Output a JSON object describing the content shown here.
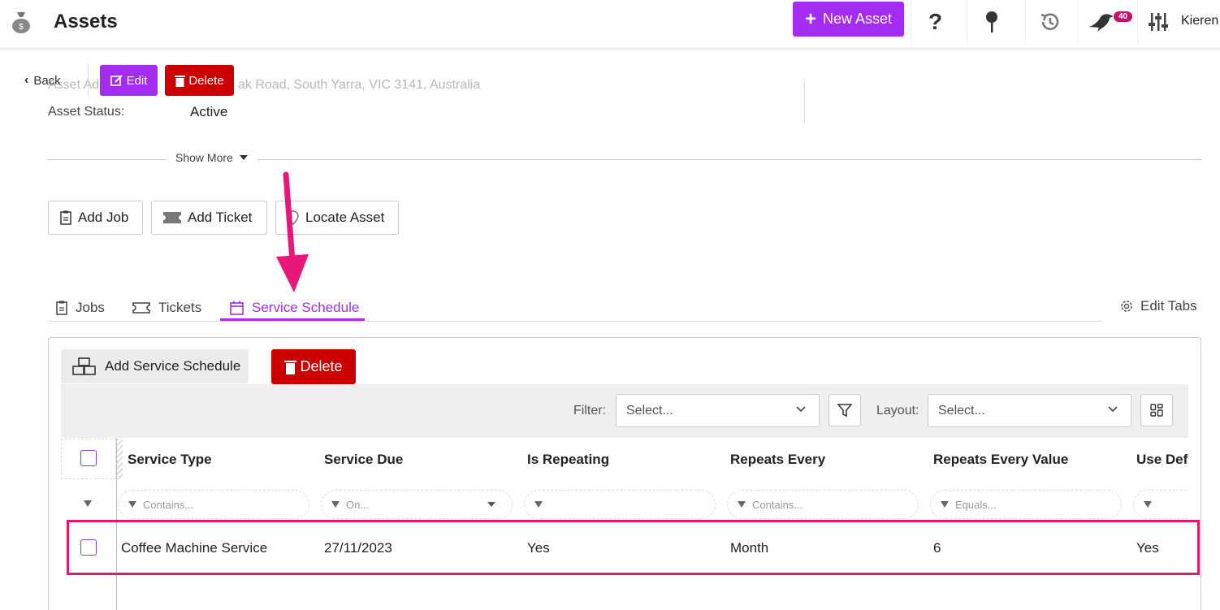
{
  "app": {
    "title": "Assets"
  },
  "topbar": {
    "new_asset_label": "New Asset",
    "notification_count": "40",
    "user_name": "Kieren"
  },
  "header": {
    "back_label": "Back",
    "edit_label": "Edit",
    "delete_label": "Delete",
    "asset_address_label_fragment": "Asset Ad",
    "asset_address_value_fragment": "ak Road, South Yarra, VIC 3141, Australia",
    "asset_status_label": "Asset Status:",
    "asset_status_value": "Active",
    "show_more_label": "Show More"
  },
  "actions": {
    "add_job": "Add Job",
    "add_ticket": "Add Ticket",
    "locate_asset": "Locate Asset"
  },
  "tabs": {
    "jobs": "Jobs",
    "tickets": "Tickets",
    "service_schedule": "Service Schedule",
    "active": "Service Schedule",
    "edit_tabs": "Edit Tabs"
  },
  "panel": {
    "add_service_schedule": "Add Service Schedule",
    "delete_label": "Delete",
    "filter_label": "Filter:",
    "filter_placeholder": "Select...",
    "layout_label": "Layout:",
    "layout_placeholder": "Select..."
  },
  "grid": {
    "columns": [
      "Service Type",
      "Service Due",
      "Is Repeating",
      "Repeats Every",
      "Repeats Every Value",
      "Use Defa"
    ],
    "filters": [
      "Contains...",
      "On...",
      "",
      "Contains...",
      "Equals...",
      ""
    ],
    "rows": [
      [
        "Coffee Machine Service",
        "27/11/2023",
        "Yes",
        "Month",
        "6",
        "Yes"
      ]
    ]
  },
  "colors": {
    "accent_purple": "#a32cf0",
    "delete_red": "#cc0000",
    "highlight_pink": "#e0196e",
    "badge": "#c4126b"
  }
}
